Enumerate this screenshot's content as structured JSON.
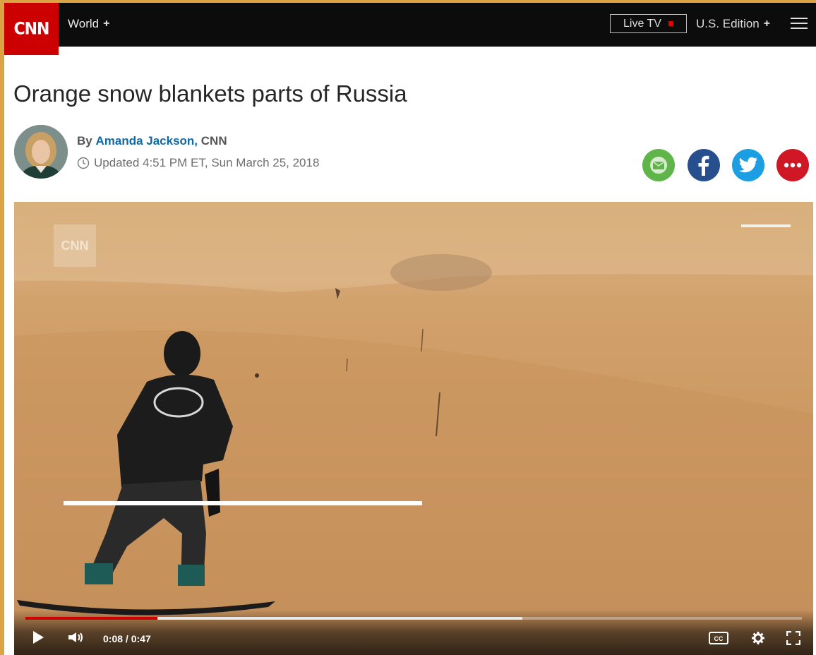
{
  "header": {
    "logo_text": "CNN",
    "nav_world": "World",
    "live_tv": "Live TV",
    "edition": "U.S. Edition"
  },
  "article": {
    "headline": "Orange snow blankets parts of Russia",
    "by_prefix": "By",
    "author": "Amanda Jackson,",
    "source": "CNN",
    "updated": "Updated 4:51 PM ET, Sun March 25, 2018"
  },
  "share": [
    "email-icon",
    "facebook-icon",
    "twitter-icon",
    "more-icon"
  ],
  "video": {
    "watermark": "CNN",
    "time_current": "0:08",
    "time_separator": "/",
    "time_total": "0:47",
    "played_fraction": 0.17,
    "buffered_fraction": 0.64,
    "cc_label": "CC"
  },
  "colors": {
    "brand_red": "#cc0000",
    "author_link": "#0c6aa8",
    "email": "#5fb54a",
    "facebook": "#274f8e",
    "twitter": "#1c9ee3",
    "more": "#cf1726"
  }
}
